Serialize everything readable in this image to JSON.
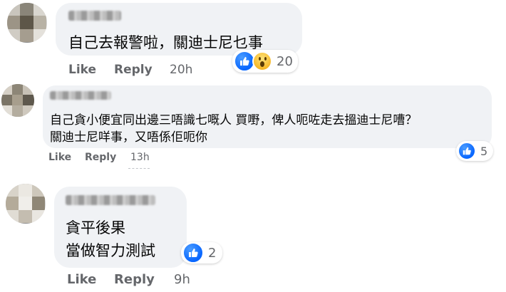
{
  "comments": [
    {
      "text_lines": [
        "自己去報警啦，關迪士尼乜事"
      ],
      "actions": {
        "like": "Like",
        "reply": "Reply",
        "time": "20h"
      },
      "reactions": {
        "icons": [
          "like-icon",
          "wow-icon"
        ],
        "count": "20"
      }
    },
    {
      "text_lines": [
        "自己貪小便宜同出邊三唔識七嘅人  買嘢，俾人呃咗走去搵迪士尼嘈？",
        "關迪士尼咩事，又唔係佢呃你"
      ],
      "actions": {
        "like": "Like",
        "reply": "Reply",
        "time": "13h"
      },
      "reactions": {
        "icons": [
          "like-icon"
        ],
        "count": "5"
      }
    },
    {
      "text_lines": [
        "貪平後果",
        "當做智力測試"
      ],
      "actions": {
        "like": "Like",
        "reply": "Reply",
        "time": "9h"
      },
      "reactions": {
        "icons": [
          "like-icon"
        ],
        "count": "2"
      }
    }
  ],
  "colors": {
    "bubble": "#f0f2f5",
    "meta_text": "#65676b",
    "like_blue": "#0866ff",
    "wow_yellow": "#f6b21e"
  }
}
